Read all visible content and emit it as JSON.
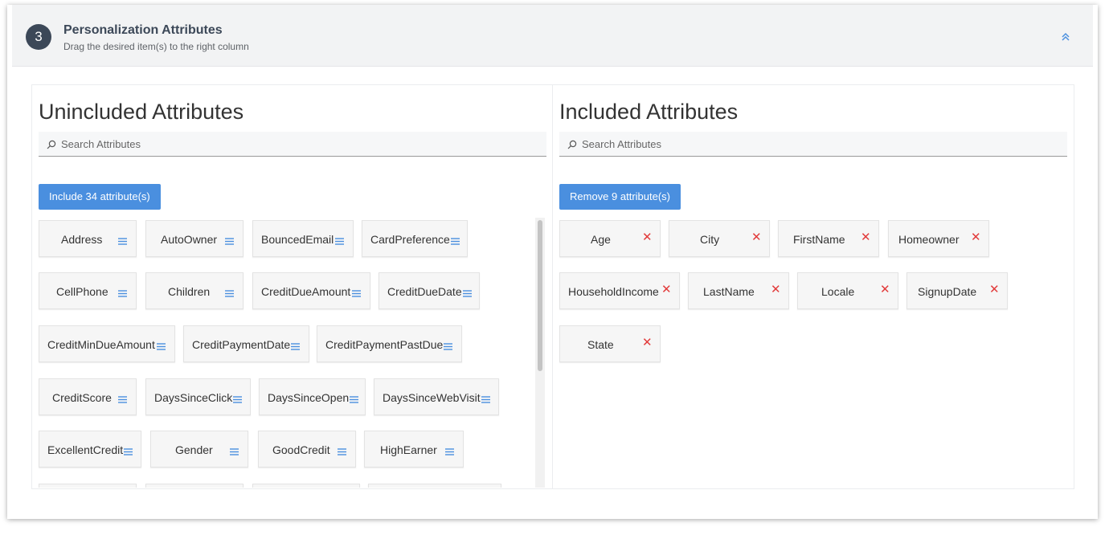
{
  "header": {
    "step": "3",
    "title": "Personalization Attributes",
    "subtitle": "Drag the desired item(s) to the right column"
  },
  "left_panel": {
    "title": "Unincluded Attributes",
    "search_placeholder": "Search Attributes",
    "button_label": "Include 34 attribute(s)",
    "items": [
      "Address",
      "AutoOwner",
      "BouncedEmail",
      "CardPreference",
      "CellPhone",
      "Children",
      "CreditDueAmount",
      "CreditDueDate",
      "CreditMinDueAmount",
      "CreditPaymentDate",
      "CreditPaymentPastDue",
      "CreditScore",
      "DaysSinceClick",
      "DaysSinceOpen",
      "DaysSinceWebVisit",
      "ExcellentCredit",
      "Gender",
      "GoodCredit",
      "HighEarner"
    ]
  },
  "right_panel": {
    "title": "Included Attributes",
    "search_placeholder": "Search Attributes",
    "button_label": "Remove 9 attribute(s)",
    "items": [
      "Age",
      "City",
      "FirstName",
      "Homeowner",
      "HouseholdIncome",
      "LastName",
      "Locale",
      "SignupDate",
      "State"
    ],
    "remove_glyph": "✕"
  },
  "colors": {
    "accent": "#4a8fdf",
    "remove": "#e23b3b",
    "header_bg": "#f2f3f4",
    "step_circle": "#3c4858"
  }
}
